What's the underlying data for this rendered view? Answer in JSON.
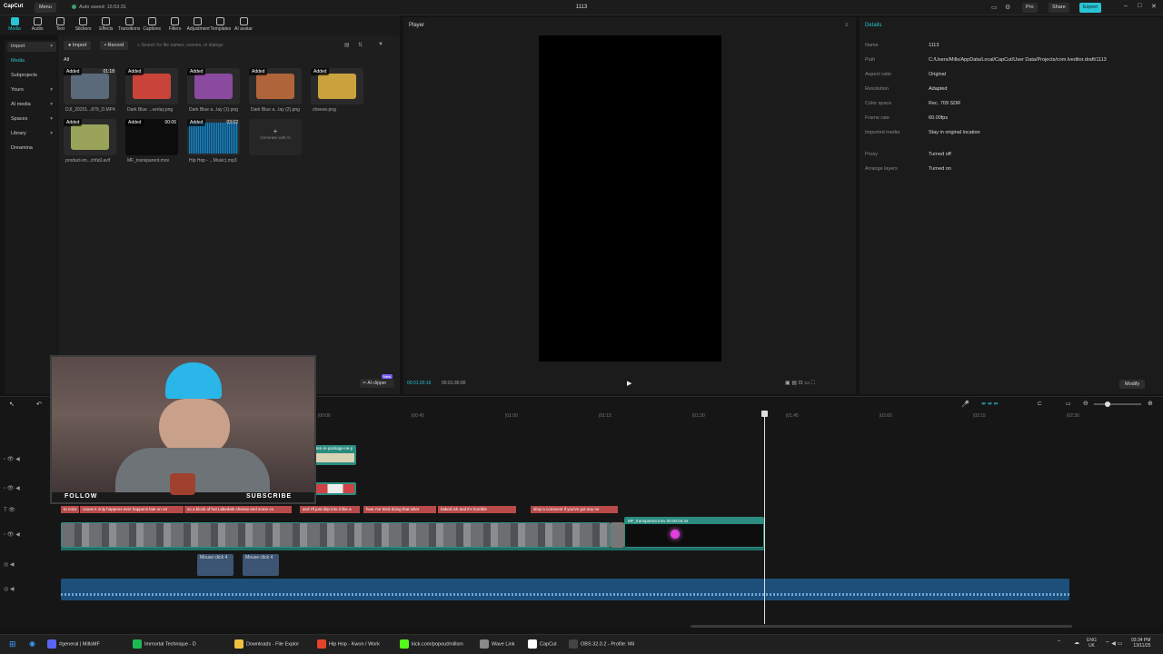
{
  "app": {
    "logo": "CapCut",
    "menu": "Menu",
    "autosave": "Auto saved: 15:53:31",
    "project_title": "1113",
    "pro": "Pro",
    "share": "Share",
    "export": "Export"
  },
  "toolbar": [
    {
      "label": "Media",
      "icon": "media-icon"
    },
    {
      "label": "Audio",
      "icon": "audio-icon"
    },
    {
      "label": "Text",
      "icon": "text-icon"
    },
    {
      "label": "Stickers",
      "icon": "stickers-icon"
    },
    {
      "label": "Effects",
      "icon": "effects-icon"
    },
    {
      "label": "Transitions",
      "icon": "transitions-icon"
    },
    {
      "label": "Captions",
      "icon": "captions-icon"
    },
    {
      "label": "Filters",
      "icon": "filters-icon"
    },
    {
      "label": "Adjustment",
      "icon": "adjustment-icon"
    },
    {
      "label": "Templates",
      "icon": "templates-icon"
    },
    {
      "label": "AI avatar",
      "icon": "ai-avatar-icon"
    }
  ],
  "leftnav": [
    "Import",
    "Media",
    "Subprojects",
    "Yours",
    "AI media",
    "Spaces",
    "Library",
    "Dreamina"
  ],
  "media": {
    "import": "Import",
    "record": "Record",
    "search_placeholder": "Search for file names, scenes, or dialogs",
    "filter_all": "All",
    "added": "Added",
    "items": [
      {
        "name": "DJI_20201...879_D.MP4",
        "duration": "01:18",
        "color": "#5a6a7a"
      },
      {
        "name": "Dark Blue ...verlay.png",
        "duration": "",
        "color": "#c8443a"
      },
      {
        "name": "Dark Blue a...lay (1).png",
        "duration": "",
        "color": "#8a4aa0"
      },
      {
        "name": "Dark Blue a...lay (2).png",
        "duration": "",
        "color": "#b0643a"
      },
      {
        "name": "cheese.png",
        "duration": "",
        "color": "#c9a23e"
      },
      {
        "name": "product-im...chfa9.avif",
        "duration": "",
        "color": "#9aa35a"
      },
      {
        "name": "MF_transparent.mov",
        "duration": "00:06",
        "color": "#0c0c0c"
      },
      {
        "name": "Hip Hop - ...Music).mp3",
        "duration": "03:02",
        "color": "#1e7fb8"
      }
    ],
    "generate": "Generate with AI"
  },
  "player": {
    "title": "Player",
    "time_current": "00:01:20:16",
    "time_total": "00:01:30:00",
    "ai_clipper": "AI clipper",
    "new": "New"
  },
  "details": {
    "title": "Details",
    "rows": [
      {
        "label": "Name",
        "value": "1113"
      },
      {
        "label": "Path",
        "value": "C:/Users/Mills/AppData/Local/CapCut/User Data/Projects/com.lveditor.draft/1113"
      },
      {
        "label": "Aspect ratio",
        "value": "Original"
      },
      {
        "label": "Resolution",
        "value": "Adapted"
      },
      {
        "label": "Color space",
        "value": "Rec. 709 SDR"
      },
      {
        "label": "Frame rate",
        "value": "60.00fps"
      },
      {
        "label": "Imported media",
        "value": "Stay in original location"
      },
      {
        "label": "Proxy",
        "value": "Turned off"
      },
      {
        "label": "Arrange layers",
        "value": "Turned on"
      }
    ],
    "modify": "Modify"
  },
  "timeline": {
    "ruler": [
      "|00:06",
      "|00:45",
      "|01:00",
      "|01:15",
      "|01:30",
      "|01:45",
      "|02:00",
      "|02:15",
      "|02:30"
    ],
    "captions": [
      {
        "text": "to mins"
      },
      {
        "text": "cause it only happens ever happens late on on"
      },
      {
        "text": "so a block of hot Lakedale cheese and some co"
      },
      {
        "text": "and I'll just drip into it like a"
      },
      {
        "text": "how I've tried doing that wher"
      },
      {
        "text": "baked ish and it's horrible"
      },
      {
        "text": "drop a comment if you've got any ne"
      }
    ],
    "overlay_clip": "MF_transparent.mov  00:00:04:44",
    "sticker_clip": "ten-in-package-ne-p",
    "sound_clips": [
      "Mouse click 4",
      "Mouse click 4"
    ]
  },
  "webcam": {
    "follow": "FOLLOW",
    "subscribe": "SUBSCRIBE"
  },
  "taskbar": [
    {
      "label": "#general | MillsMF",
      "color": "#5865f2"
    },
    {
      "label": "Immortal Technique - D",
      "color": "#1db954"
    },
    {
      "label": "Downloads - File Explor",
      "color": "#f0c040"
    },
    {
      "label": "Hip Hop - Kwon / Work",
      "color": "#e0452a"
    },
    {
      "label": "kick.com/popout/millsm",
      "color": "#53fc18"
    },
    {
      "label": "Wave Link",
      "color": "#888888"
    },
    {
      "label": "CapCut",
      "color": "#ffffff"
    },
    {
      "label": "OBS 32.0.2 - Profile: Mil",
      "color": "#444444"
    }
  ],
  "tray": {
    "lang": "ENG",
    "region": "UK",
    "time": "03:34 PM",
    "date": "13/11/25"
  }
}
